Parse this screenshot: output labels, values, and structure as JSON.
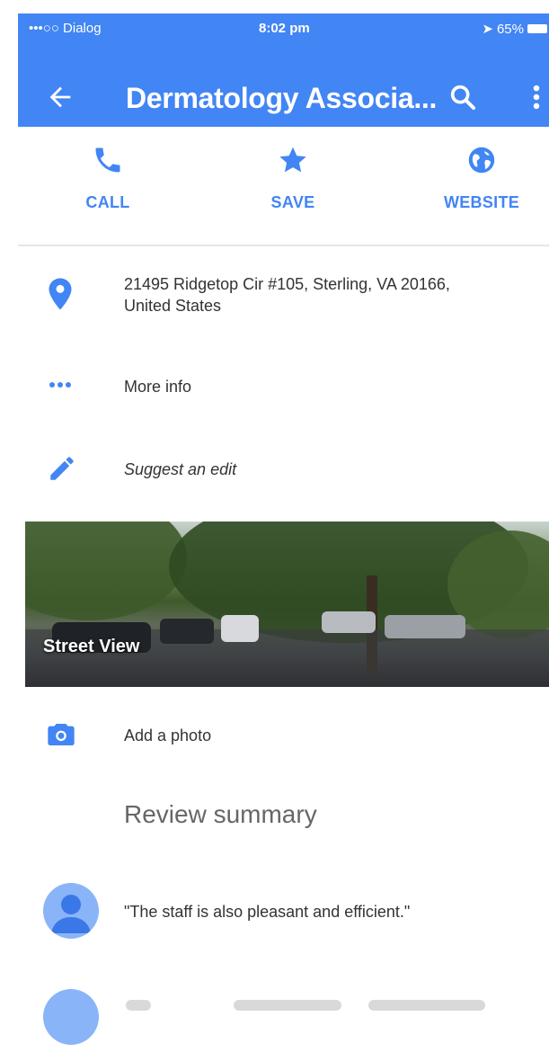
{
  "status_bar": {
    "carrier": "•••○○ Dialog",
    "time": "8:02 pm",
    "battery": "65%"
  },
  "toolbar": {
    "title": "Dermatology Associa...",
    "icons": {
      "back": "arrow-back-icon",
      "search": "search-icon",
      "more": "more-vert-icon"
    }
  },
  "actions": [
    {
      "label": "CALL",
      "icon": "phone-icon"
    },
    {
      "label": "SAVE",
      "icon": "star-icon"
    },
    {
      "label": "WEBSITE",
      "icon": "globe-icon"
    }
  ],
  "details": {
    "address_line1": "21495 Ridgetop Cir #105, Sterling, VA 20166,",
    "address_line2": "United States",
    "more_info": "More info",
    "suggest_edit": "Suggest an edit"
  },
  "street_view": {
    "label": "Street View"
  },
  "add_photo": {
    "label": "Add a photo"
  },
  "review": {
    "title": "Review summary",
    "quote": "\"The staff is also pleasant and efficient.\""
  },
  "colors": {
    "accent": "#4285f4",
    "avatar": "#8ab4f8",
    "avatar_fg": "#3b78e7"
  }
}
